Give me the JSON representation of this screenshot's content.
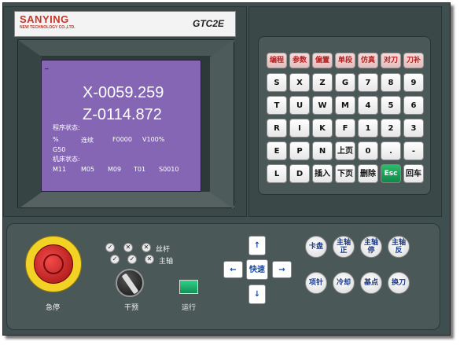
{
  "brand": {
    "name": "SANYING",
    "subtitle": "NEW TECHNOLOGY CO.,LTD.",
    "model": "GTC2E"
  },
  "screen": {
    "cursor": "_",
    "x": "X-0059.259",
    "z": "Z-0114.872",
    "program_status_label": "程序状态:",
    "percent": "%",
    "mode": "连续",
    "feed": "F0000",
    "override": "V100%",
    "gcode": "G50",
    "machine_status_label": "机床状态:",
    "m1": "M11",
    "m2": "M05",
    "m3": "M09",
    "tool": "T01",
    "spindle": "S0010"
  },
  "function_keys": [
    "编程",
    "参数",
    "偏置",
    "单段",
    "仿真",
    "对刀",
    "刀补"
  ],
  "keys": [
    [
      "S",
      "X",
      "Z",
      "G",
      "7",
      "8",
      "9"
    ],
    [
      "T",
      "U",
      "W",
      "M",
      "4",
      "5",
      "6"
    ],
    [
      "R",
      "I",
      "K",
      "F",
      "1",
      "2",
      "3"
    ],
    [
      "E",
      "P",
      "N",
      "上页",
      "0",
      ".",
      "-"
    ],
    [
      "L",
      "D",
      "插入",
      "下页",
      "删除",
      "Esc",
      "回车"
    ]
  ],
  "indicators": {
    "row1_label": "丝杆",
    "row2_label": "主轴",
    "mark_check": "✓",
    "mark_x": "✕"
  },
  "controls": {
    "estop_label": "急停",
    "intervene_label": "干预",
    "run_label": "运行",
    "jog_up": "↑",
    "jog_down": "↓",
    "jog_left": "←",
    "jog_right": "→",
    "rapid": "快速"
  },
  "function_buttons": [
    [
      "卡盘",
      "主轴 正",
      "主轴 停",
      "主轴 反"
    ],
    [
      "项针",
      "冷却",
      "基点",
      "换刀"
    ]
  ],
  "colors": {
    "lcd": "#8466b4",
    "panel": "#3f4e4e",
    "estop": "#d01a1a",
    "estop_base": "#f2d224",
    "esc_key": "#10884a"
  }
}
